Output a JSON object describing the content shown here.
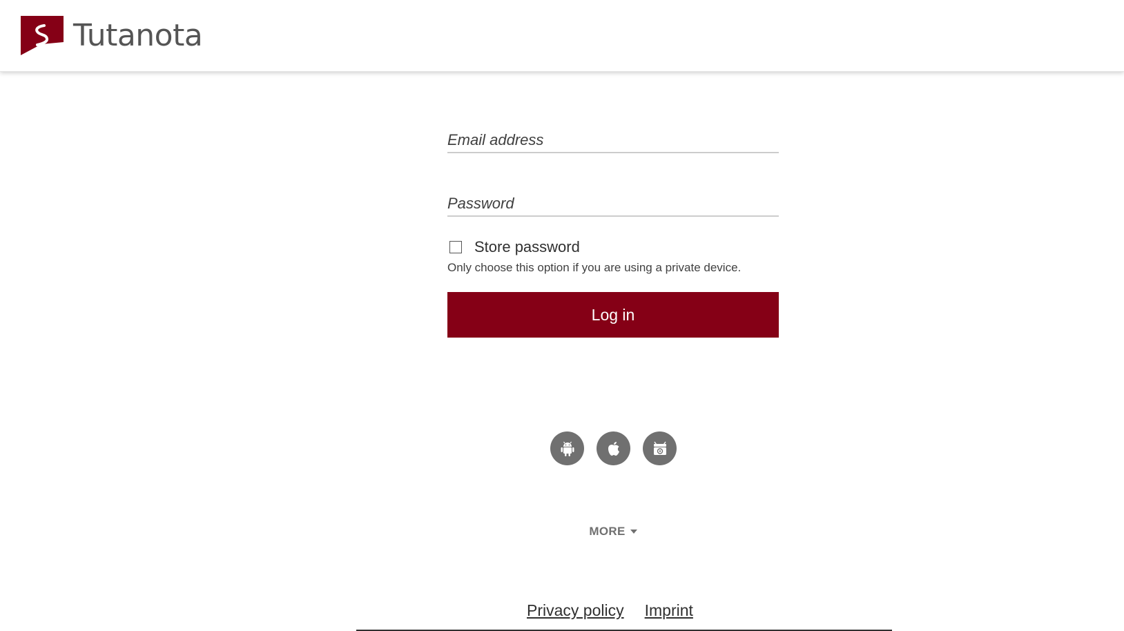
{
  "header": {
    "logo_text_light": "Tuta",
    "logo_text_bold": "nota",
    "logo_color": "#850016"
  },
  "login": {
    "email_placeholder": "Email address",
    "password_placeholder": "Password",
    "store_password_label": "Store password",
    "store_password_checked": false,
    "store_password_hint": "Only choose this option if you are using a private device.",
    "login_button_label": "Log in",
    "button_color": "#850016"
  },
  "apps": [
    {
      "icon": "android-icon"
    },
    {
      "icon": "apple-icon"
    },
    {
      "icon": "fdroid-icon"
    }
  ],
  "more": {
    "label": "MORE"
  },
  "footer": {
    "privacy_label": "Privacy policy",
    "imprint_label": "Imprint"
  }
}
